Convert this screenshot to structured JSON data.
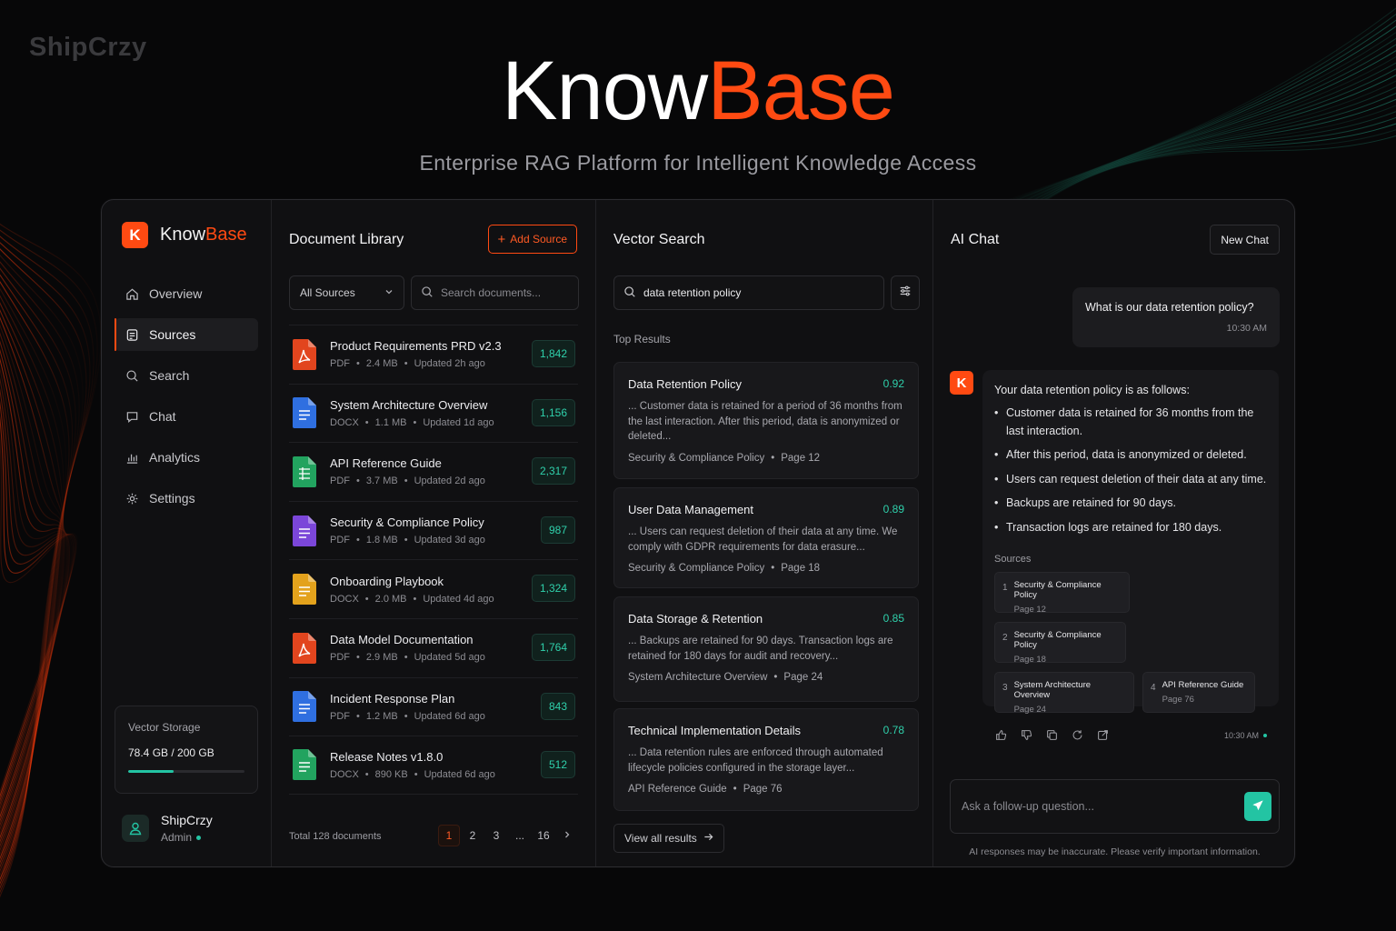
{
  "watermark": "ShipCrzy",
  "hero": {
    "title_a": "Know",
    "title_b": "Base",
    "subtitle": "Enterprise RAG Platform for Intelligent Knowledge Access"
  },
  "colors": {
    "accent": "#ff4a12",
    "teal": "#23c4a3",
    "bg": "#070708",
    "panel": "#101012"
  },
  "sidebar": {
    "logo_letter": "K",
    "brand_a": "Know",
    "brand_b": "Base",
    "items": [
      {
        "label": "Overview",
        "icon": "home-icon"
      },
      {
        "label": "Sources",
        "icon": "database-icon",
        "active": true
      },
      {
        "label": "Search",
        "icon": "search-icon"
      },
      {
        "label": "Chat",
        "icon": "chat-bubble-icon"
      },
      {
        "label": "Analytics",
        "icon": "bar-chart-icon"
      },
      {
        "label": "Settings",
        "icon": "gear-icon"
      }
    ],
    "storage": {
      "label": "Vector Storage",
      "value": "78.4 GB / 200 GB",
      "fraction": 0.392
    },
    "user": {
      "name": "ShipCrzy",
      "role": "Admin"
    }
  },
  "library": {
    "title": "Document Library",
    "add_label": "Add Source",
    "filter_value": "All Sources",
    "search_placeholder": "Search documents...",
    "docs": [
      {
        "name": "Product Requirements PRD v2.3",
        "type": "PDF",
        "size": "2.4 MB",
        "updated": "Updated 2h ago",
        "chunks": "1,842",
        "icon": "pdf-file-icon",
        "color": "#e2451e"
      },
      {
        "name": "System Architecture Overview",
        "type": "DOCX",
        "size": "1.1 MB",
        "updated": "Updated 1d ago",
        "chunks": "1,156",
        "icon": "doc-file-icon",
        "color": "#2f6fe0"
      },
      {
        "name": "API Reference Guide",
        "type": "PDF",
        "size": "3.7 MB",
        "updated": "Updated 2d ago",
        "chunks": "2,317",
        "icon": "sheet-file-icon",
        "color": "#22a35f"
      },
      {
        "name": "Security & Compliance Policy",
        "type": "PDF",
        "size": "1.8 MB",
        "updated": "Updated 3d ago",
        "chunks": "987",
        "icon": "doc-file-icon",
        "color": "#7b46d9"
      },
      {
        "name": "Onboarding Playbook",
        "type": "DOCX",
        "size": "2.0 MB",
        "updated": "Updated 4d ago",
        "chunks": "1,324",
        "icon": "doc-file-icon",
        "color": "#e3a21c"
      },
      {
        "name": "Data Model Documentation",
        "type": "PDF",
        "size": "2.9 MB",
        "updated": "Updated 5d ago",
        "chunks": "1,764",
        "icon": "pdf-file-icon",
        "color": "#e2451e"
      },
      {
        "name": "Incident Response Plan",
        "type": "PDF",
        "size": "1.2 MB",
        "updated": "Updated 6d ago",
        "chunks": "843",
        "icon": "doc-file-icon",
        "color": "#2f6fe0"
      },
      {
        "name": "Release Notes v1.8.0",
        "type": "DOCX",
        "size": "890 KB",
        "updated": "Updated 6d ago",
        "chunks": "512",
        "icon": "doc-file-icon",
        "color": "#22a35f"
      }
    ],
    "total": "Total 128 documents",
    "pages": [
      "1",
      "2",
      "3",
      "...",
      "16"
    ]
  },
  "vector": {
    "title": "Vector Search",
    "query": "data retention policy",
    "top_results_label": "Top Results",
    "results": [
      {
        "title": "Data Retention Policy",
        "score": "0.92",
        "snippet": "... Customer data is retained for a period of 36 months from the last interaction. After this period, data is anonymized or deleted...",
        "source": "Security & Compliance Policy",
        "page": "Page 12"
      },
      {
        "title": "User Data Management",
        "score": "0.89",
        "snippet": "... Users can request deletion of their data at any time. We comply with GDPR requirements for data erasure...",
        "source": "Security & Compliance Policy",
        "page": "Page 18"
      },
      {
        "title": "Data Storage & Retention",
        "score": "0.85",
        "snippet": "... Backups are retained for 90 days. Transaction logs are retained for 180 days for audit and recovery...",
        "source": "System Architecture Overview",
        "page": "Page 24"
      },
      {
        "title": "Technical Implementation Details",
        "score": "0.78",
        "snippet": "... Data retention rules are enforced through automated lifecycle policies configured in the storage layer...",
        "source": "API Reference Guide",
        "page": "Page 76"
      }
    ],
    "view_all_label": "View all results"
  },
  "chat": {
    "title": "AI Chat",
    "new_chat_label": "New Chat",
    "user_msg": {
      "text": "What is our data retention policy?",
      "time": "10:30 AM"
    },
    "ai_logo_letter": "K",
    "ai_msg": {
      "intro": "Your data retention policy is as follows:",
      "bullets": [
        "Customer data is retained for 36 months from the last interaction.",
        "After this period, data is anonymized or deleted.",
        "Users can request deletion of their data at any time.",
        "Backups are retained for 90 days.",
        "Transaction logs are retained for 180 days."
      ],
      "sources_label": "Sources",
      "sources": [
        {
          "num": "1",
          "title": "Security & Compliance Policy",
          "page": "Page 12"
        },
        {
          "num": "2",
          "title": "Security & Compliance Policy",
          "page": "Page 18"
        },
        {
          "num": "3",
          "title": "System Architecture Overview",
          "page": "Page 24"
        },
        {
          "num": "4",
          "title": "API Reference Guide",
          "page": "Page 76"
        }
      ],
      "time": "10:30 AM"
    },
    "input_placeholder": "Ask a follow-up question...",
    "disclaimer": "AI responses may be inaccurate. Please verify important information."
  }
}
